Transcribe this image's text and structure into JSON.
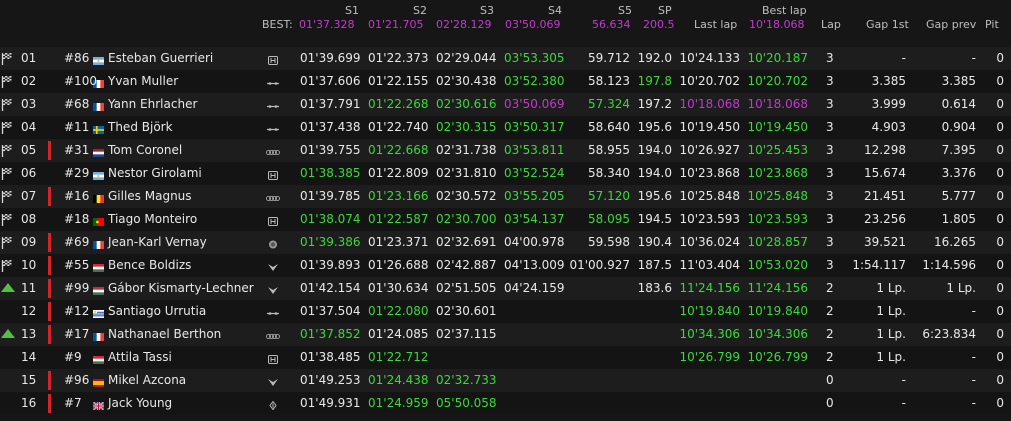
{
  "colors": {
    "green": "#3cd83c",
    "purple": "#c03bcb",
    "white": "#e8e8e8",
    "red_marker": "#d4242a",
    "arrow_green": "#54c043"
  },
  "header": {
    "best_label": "BEST:",
    "s1": {
      "title": "S1",
      "best": "01'37.328"
    },
    "s2": {
      "title": "S2",
      "best": "01'21.705"
    },
    "s3": {
      "title": "S3",
      "best": "02'28.129"
    },
    "s4": {
      "title": "S4",
      "best": "03'50.069"
    },
    "s5": {
      "title": "S5",
      "best": "56.634"
    },
    "sp": {
      "title": "SP",
      "best": "200.5"
    },
    "last_lap": "Last lap",
    "best_lap_title": "Best lap",
    "best_lap": "10'18.068",
    "lap": "Lap",
    "gap_1st": "Gap 1st",
    "gap_prev": "Gap prev",
    "pit": "Pit"
  },
  "rows": [
    {
      "pos": "01",
      "num": "#86",
      "driver": "Esteban Guerrieri",
      "country": "ar",
      "car": "honda",
      "icon": "flag",
      "bar": false,
      "s1": "01'39.699",
      "s1c": "white",
      "s2": "01'22.373",
      "s2c": "white",
      "s3": "02'29.044",
      "s3c": "white",
      "s4": "03'53.305",
      "s4c": "green",
      "s5": "59.712",
      "s5c": "white",
      "sp": "192.0",
      "spc": "white",
      "last": "10'24.133",
      "lastc": "white",
      "best": "10'20.187",
      "bestc": "green",
      "lap": "3",
      "gap1": "-",
      "gapp": "-",
      "pit": "0"
    },
    {
      "pos": "02",
      "num": "#100",
      "driver": "Yvan Muller",
      "country": "fr",
      "car": "lynk",
      "icon": "flag",
      "bar": false,
      "s1": "01'37.606",
      "s1c": "white",
      "s2": "01'22.155",
      "s2c": "white",
      "s3": "02'30.438",
      "s3c": "white",
      "s4": "03'52.380",
      "s4c": "green",
      "s5": "58.123",
      "s5c": "white",
      "sp": "197.8",
      "spc": "green",
      "last": "10'20.702",
      "lastc": "white",
      "best": "10'20.702",
      "bestc": "green",
      "lap": "3",
      "gap1": "3.385",
      "gapp": "3.385",
      "pit": "0"
    },
    {
      "pos": "03",
      "num": "#68",
      "driver": "Yann Ehrlacher",
      "country": "fr",
      "car": "lynk",
      "icon": "flag",
      "bar": false,
      "s1": "01'37.791",
      "s1c": "white",
      "s2": "01'22.268",
      "s2c": "green",
      "s3": "02'30.616",
      "s3c": "green",
      "s4": "03'50.069",
      "s4c": "purple",
      "s5": "57.324",
      "s5c": "green",
      "sp": "197.2",
      "spc": "white",
      "last": "10'18.068",
      "lastc": "purple",
      "best": "10'18.068",
      "bestc": "purple",
      "lap": "3",
      "gap1": "3.999",
      "gapp": "0.614",
      "pit": "0"
    },
    {
      "pos": "04",
      "num": "#11",
      "driver": "Thed Björk",
      "country": "se",
      "car": "lynk",
      "icon": "flag",
      "bar": false,
      "s1": "01'37.438",
      "s1c": "white",
      "s2": "01'22.740",
      "s2c": "white",
      "s3": "02'30.315",
      "s3c": "green",
      "s4": "03'50.317",
      "s4c": "green",
      "s5": "58.640",
      "s5c": "white",
      "sp": "195.6",
      "spc": "white",
      "last": "10'19.450",
      "lastc": "white",
      "best": "10'19.450",
      "bestc": "green",
      "lap": "3",
      "gap1": "4.903",
      "gapp": "0.904",
      "pit": "0"
    },
    {
      "pos": "05",
      "num": "#31",
      "driver": "Tom Coronel",
      "country": "nl",
      "car": "audi",
      "icon": "flag",
      "bar": true,
      "s1": "01'39.755",
      "s1c": "white",
      "s2": "01'22.668",
      "s2c": "green",
      "s3": "02'31.738",
      "s3c": "white",
      "s4": "03'53.811",
      "s4c": "green",
      "s5": "58.955",
      "s5c": "white",
      "sp": "194.0",
      "spc": "white",
      "last": "10'26.927",
      "lastc": "white",
      "best": "10'25.453",
      "bestc": "green",
      "lap": "3",
      "gap1": "12.298",
      "gapp": "7.395",
      "pit": "0"
    },
    {
      "pos": "06",
      "num": "#29",
      "driver": "Nestor Girolami",
      "country": "ar",
      "car": "honda",
      "icon": "flag",
      "bar": false,
      "s1": "01'38.385",
      "s1c": "green",
      "s2": "01'22.809",
      "s2c": "white",
      "s3": "02'31.810",
      "s3c": "white",
      "s4": "03'52.524",
      "s4c": "green",
      "s5": "58.340",
      "s5c": "white",
      "sp": "194.0",
      "spc": "white",
      "last": "10'23.868",
      "lastc": "white",
      "best": "10'23.868",
      "bestc": "green",
      "lap": "3",
      "gap1": "15.674",
      "gapp": "3.376",
      "pit": "0"
    },
    {
      "pos": "07",
      "num": "#16",
      "driver": "Gilles Magnus",
      "country": "be",
      "car": "audi",
      "icon": "flag",
      "bar": true,
      "s1": "01'39.785",
      "s1c": "white",
      "s2": "01'23.166",
      "s2c": "green",
      "s3": "02'30.572",
      "s3c": "white",
      "s4": "03'55.205",
      "s4c": "green",
      "s5": "57.120",
      "s5c": "green",
      "sp": "195.6",
      "spc": "white",
      "last": "10'25.848",
      "lastc": "white",
      "best": "10'25.848",
      "bestc": "green",
      "lap": "3",
      "gap1": "21.451",
      "gapp": "5.777",
      "pit": "0"
    },
    {
      "pos": "08",
      "num": "#18",
      "driver": "Tiago Monteiro",
      "country": "pt",
      "car": "honda",
      "icon": "flag",
      "bar": false,
      "s1": "01'38.074",
      "s1c": "green",
      "s2": "01'22.587",
      "s2c": "green",
      "s3": "02'30.700",
      "s3c": "green",
      "s4": "03'54.137",
      "s4c": "green",
      "s5": "58.095",
      "s5c": "green",
      "sp": "194.5",
      "spc": "white",
      "last": "10'23.593",
      "lastc": "white",
      "best": "10'23.593",
      "bestc": "green",
      "lap": "3",
      "gap1": "23.256",
      "gapp": "1.805",
      "pit": "0"
    },
    {
      "pos": "09",
      "num": "#69",
      "driver": "Jean-Karl Vernay",
      "country": "fr",
      "car": "alfa",
      "icon": "flag",
      "bar": true,
      "s1": "01'39.386",
      "s1c": "green",
      "s2": "01'23.371",
      "s2c": "white",
      "s3": "02'32.691",
      "s3c": "white",
      "s4": "04'00.978",
      "s4c": "white",
      "s5": "59.598",
      "s5c": "white",
      "sp": "190.4",
      "spc": "white",
      "last": "10'36.024",
      "lastc": "white",
      "best": "10'28.857",
      "bestc": "green",
      "lap": "3",
      "gap1": "39.521",
      "gapp": "16.265",
      "pit": "0"
    },
    {
      "pos": "10",
      "num": "#55",
      "driver": "Bence Boldizs",
      "country": "hu",
      "car": "cupra",
      "icon": "flag",
      "bar": true,
      "s1": "01'39.893",
      "s1c": "white",
      "s2": "01'26.688",
      "s2c": "white",
      "s3": "02'42.887",
      "s3c": "white",
      "s4": "04'13.009",
      "s4c": "white",
      "s5": "01'00.927",
      "s5c": "white",
      "sp": "187.5",
      "spc": "white",
      "last": "11'03.404",
      "lastc": "white",
      "best": "10'53.020",
      "bestc": "green",
      "lap": "3",
      "gap1": "1:54.117",
      "gapp": "1:14.596",
      "pit": "0"
    },
    {
      "pos": "11",
      "num": "#99",
      "driver": "Gábor Kismarty-Lechner",
      "country": "hu",
      "car": "cupra",
      "icon": "arrow",
      "bar": true,
      "s1": "01'42.154",
      "s1c": "white",
      "s2": "01'30.634",
      "s2c": "white",
      "s3": "02'51.505",
      "s3c": "white",
      "s4": "04'24.159",
      "s4c": "white",
      "s5": "",
      "s5c": "white",
      "sp": "183.6",
      "spc": "white",
      "last": "11'24.156",
      "lastc": "green",
      "best": "11'24.156",
      "bestc": "green",
      "lap": "2",
      "gap1": "1 Lp.",
      "gapp": "1 Lp.",
      "pit": "0"
    },
    {
      "pos": "12",
      "num": "#12",
      "driver": "Santiago Urrutia",
      "country": "uy",
      "car": "lynk",
      "icon": "none",
      "bar": true,
      "s1": "01'37.504",
      "s1c": "white",
      "s2": "01'22.080",
      "s2c": "green",
      "s3": "02'30.601",
      "s3c": "white",
      "s4": "",
      "s4c": "white",
      "s5": "",
      "s5c": "white",
      "sp": "",
      "spc": "white",
      "last": "10'19.840",
      "lastc": "green",
      "best": "10'19.840",
      "bestc": "green",
      "lap": "2",
      "gap1": "1 Lp.",
      "gapp": "-",
      "pit": "0"
    },
    {
      "pos": "13",
      "num": "#17",
      "driver": "Nathanael Berthon",
      "country": "fr",
      "car": "audi",
      "icon": "arrow",
      "bar": true,
      "s1": "01'37.852",
      "s1c": "green",
      "s2": "01'24.085",
      "s2c": "white",
      "s3": "02'37.115",
      "s3c": "white",
      "s4": "",
      "s4c": "white",
      "s5": "",
      "s5c": "white",
      "sp": "",
      "spc": "white",
      "last": "10'34.306",
      "lastc": "green",
      "best": "10'34.306",
      "bestc": "green",
      "lap": "2",
      "gap1": "1 Lp.",
      "gapp": "6:23.834",
      "pit": "0"
    },
    {
      "pos": "14",
      "num": "#9",
      "driver": "Attila Tassi",
      "country": "hu",
      "car": "honda",
      "icon": "none",
      "bar": false,
      "s1": "01'38.485",
      "s1c": "white",
      "s2": "01'22.712",
      "s2c": "green",
      "s3": "",
      "s3c": "white",
      "s4": "",
      "s4c": "white",
      "s5": "",
      "s5c": "white",
      "sp": "",
      "spc": "white",
      "last": "10'26.799",
      "lastc": "green",
      "best": "10'26.799",
      "bestc": "green",
      "lap": "2",
      "gap1": "1 Lp.",
      "gapp": "-",
      "pit": "0"
    },
    {
      "pos": "15",
      "num": "#96",
      "driver": "Mikel Azcona",
      "country": "es",
      "car": "cupra",
      "icon": "none",
      "bar": true,
      "s1": "01'49.253",
      "s1c": "white",
      "s2": "01'24.438",
      "s2c": "green",
      "s3": "02'32.733",
      "s3c": "green",
      "s4": "",
      "s4c": "white",
      "s5": "",
      "s5c": "white",
      "sp": "",
      "spc": "white",
      "last": "",
      "lastc": "white",
      "best": "",
      "bestc": "white",
      "lap": "0",
      "gap1": "-",
      "gapp": "-",
      "pit": "0"
    },
    {
      "pos": "16",
      "num": "#7",
      "driver": "Jack Young",
      "country": "gb",
      "car": "hyundai",
      "icon": "none",
      "bar": true,
      "s1": "01'49.931",
      "s1c": "white",
      "s2": "01'24.959",
      "s2c": "green",
      "s3": "05'50.058",
      "s3c": "green",
      "s4": "",
      "s4c": "white",
      "s5": "",
      "s5c": "white",
      "sp": "",
      "spc": "white",
      "last": "",
      "lastc": "white",
      "best": "",
      "bestc": "white",
      "lap": "0",
      "gap1": "-",
      "gapp": "-",
      "pit": "0"
    }
  ]
}
